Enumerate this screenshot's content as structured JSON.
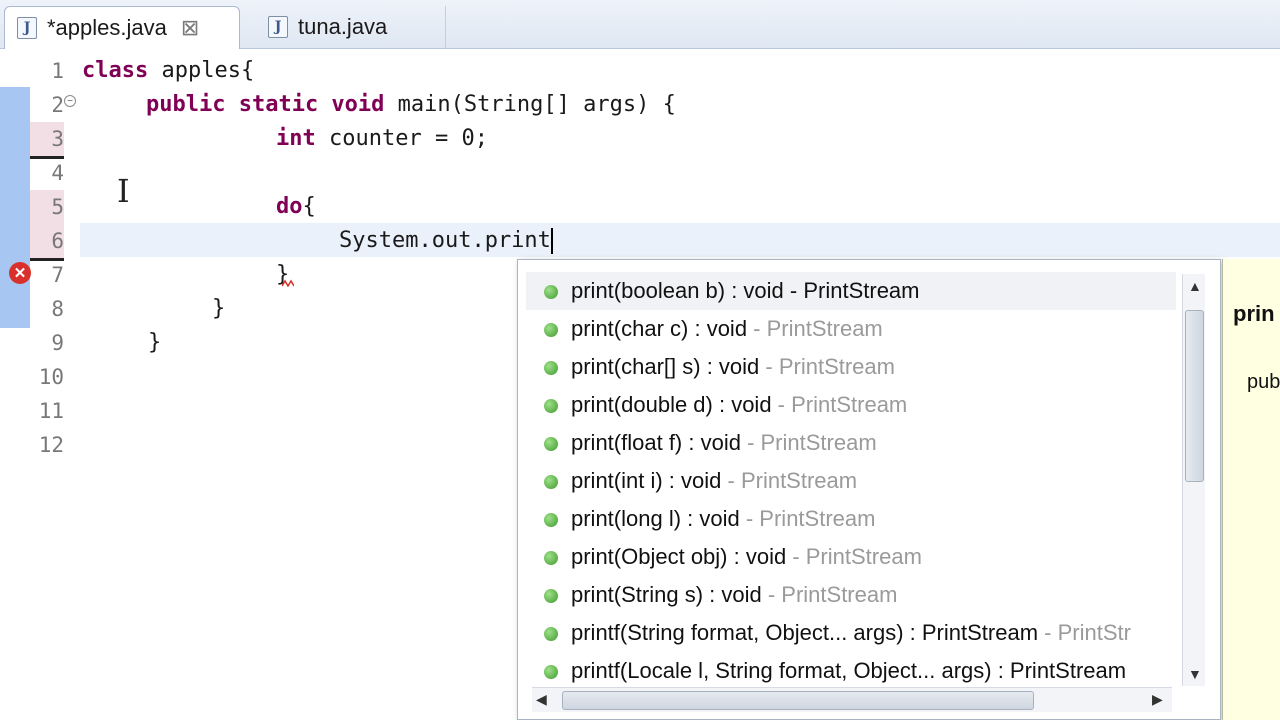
{
  "tabs": [
    {
      "label": "*apples.java",
      "icon": "java-file-icon",
      "active": true,
      "close": "⊠"
    },
    {
      "label": "tuna.java",
      "icon": "java-file-icon",
      "active": false
    }
  ],
  "editor": {
    "line_numbers": [
      "1",
      "2",
      "3",
      "4",
      "5",
      "6",
      "7",
      "8",
      "9",
      "10",
      "11",
      "12"
    ],
    "lines": {
      "l1_kw": "class",
      "l1_rest": " apples{",
      "l2_kw": "public static void",
      "l2_rest": " main(String[] args) {",
      "l3_kw": "int",
      "l3_rest": " counter = 0;",
      "l5_kw": "do",
      "l5_rest": "{",
      "l6": "System.out.print",
      "l7": "}",
      "l8": "}",
      "l9": "}"
    }
  },
  "content_assist": {
    "proposals": [
      {
        "sig": "print(boolean b) : void",
        "owner": " - PrintStream"
      },
      {
        "sig": "print(char c) : void",
        "owner": " - PrintStream"
      },
      {
        "sig": "print(char[] s) : void",
        "owner": " - PrintStream"
      },
      {
        "sig": "print(double d) : void",
        "owner": " - PrintStream"
      },
      {
        "sig": "print(float f) : void",
        "owner": " - PrintStream"
      },
      {
        "sig": "print(int i) : void",
        "owner": " - PrintStream"
      },
      {
        "sig": "print(long l) : void",
        "owner": " - PrintStream"
      },
      {
        "sig": "print(Object obj) : void",
        "owner": " - PrintStream"
      },
      {
        "sig": "print(String s) : void",
        "owner": " - PrintStream"
      },
      {
        "sig": "printf(String format, Object... args) : PrintStream",
        "owner": " - PrintStr"
      },
      {
        "sig": "printf(Locale l, String format, Object... args) : PrintStream",
        "owner": ""
      }
    ]
  },
  "javadoc": {
    "title": "prin",
    "body": "pub"
  },
  "colors": {
    "keyword": "#7f0055",
    "change_bar": "#a7c6f2",
    "error": "#d9302c",
    "method_dot": "#3f9a2e"
  }
}
